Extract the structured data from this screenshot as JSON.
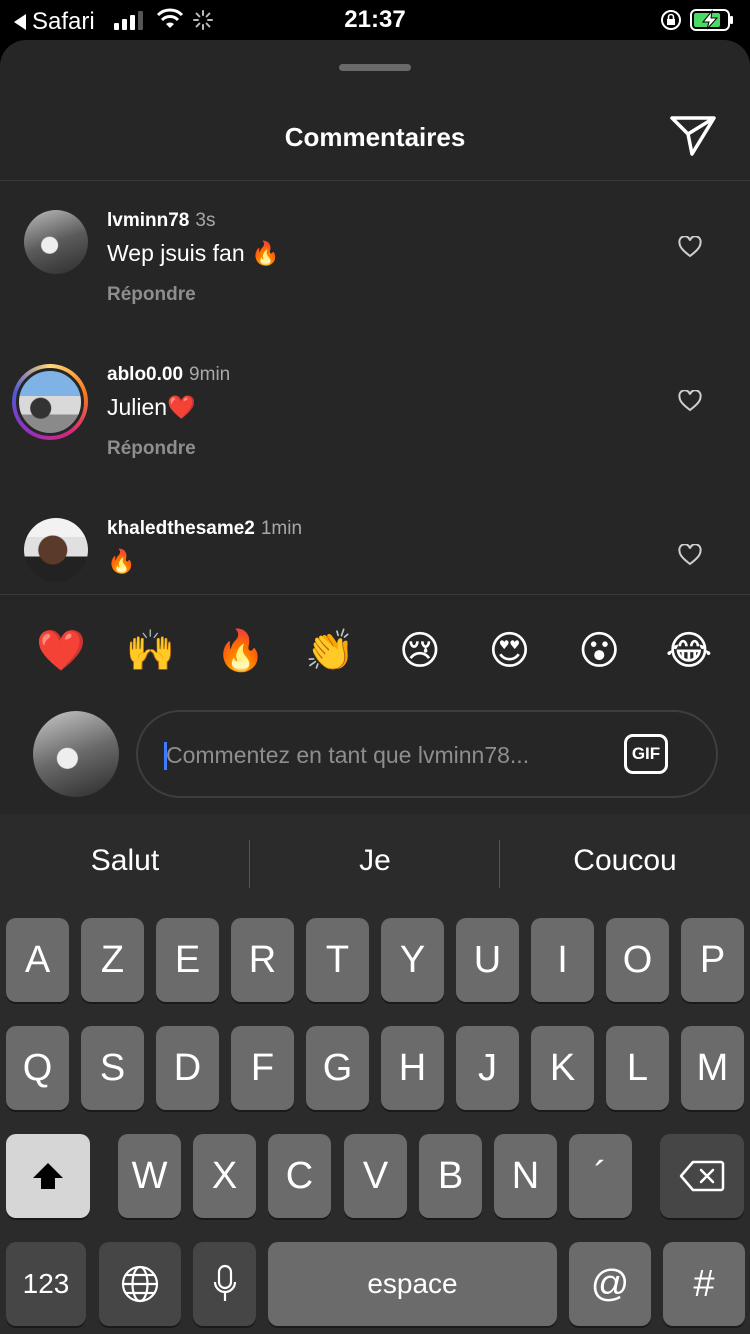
{
  "status_bar": {
    "back_app": "Safari",
    "time": "21:37"
  },
  "sheet": {
    "title": "Commentaires"
  },
  "comments": [
    {
      "username": "lvminn78",
      "time": "3s",
      "text": "Wep jsuis fan 🔥",
      "reply_label": "Répondre"
    },
    {
      "username": "ablo0.00",
      "time": "9min",
      "text": "Julien❤️",
      "reply_label": "Répondre"
    },
    {
      "username": "khaledthesame2",
      "time": "1min",
      "text": "🔥"
    }
  ],
  "quick_emojis": [
    "❤️",
    "🙌",
    "🔥",
    "👏",
    "😢",
    "😍",
    "😮",
    "😂"
  ],
  "comment_input": {
    "placeholder": "Commentez en tant que lvminn78...",
    "gif_label": "GIF"
  },
  "keyboard": {
    "suggestions": [
      "Salut",
      "Je",
      "Coucou"
    ],
    "row1": [
      "A",
      "Z",
      "E",
      "R",
      "T",
      "Y",
      "U",
      "I",
      "O",
      "P"
    ],
    "row2": [
      "Q",
      "S",
      "D",
      "F",
      "G",
      "H",
      "J",
      "K",
      "L",
      "M"
    ],
    "row3": [
      "W",
      "X",
      "C",
      "V",
      "B",
      "N",
      "´"
    ],
    "numbers_label": "123",
    "space_label": "espace",
    "at_label": "@",
    "hash_label": "#"
  }
}
